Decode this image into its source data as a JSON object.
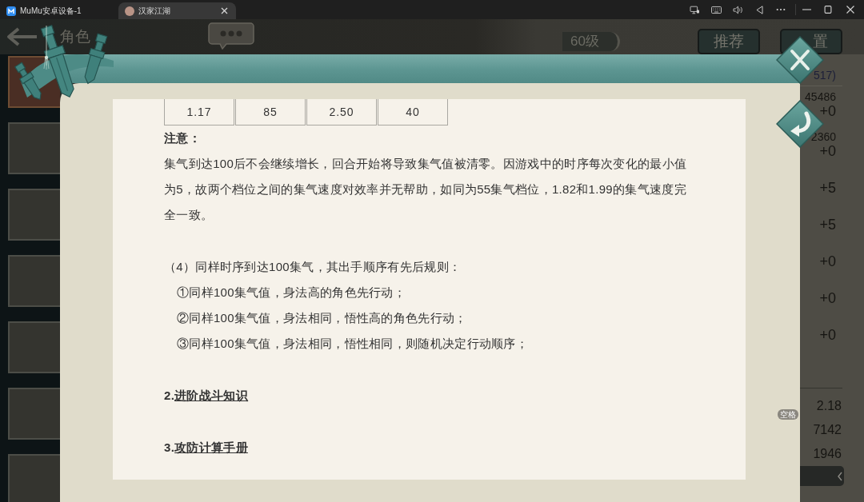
{
  "window": {
    "tabs": [
      {
        "kind": "launcher",
        "label": "MuMu安卓设备-1",
        "selected": false
      },
      {
        "kind": "app",
        "label": "汉家江湖",
        "selected": true
      }
    ]
  },
  "game": {
    "header": {
      "title": "角色",
      "level": "60级",
      "buttons": [
        "推荐",
        "置"
      ]
    },
    "portraits": [
      {
        "selected": true
      },
      {
        "selected": false
      },
      {
        "selected": false
      },
      {
        "selected": false
      },
      {
        "selected": false
      },
      {
        "selected": false
      },
      {
        "selected": false
      }
    ],
    "stats": {
      "header": "517)",
      "pairs": [
        {
          "value": "45486",
          "bonus": "+0"
        },
        {
          "value": "2360",
          "bonus": "+0"
        }
      ],
      "bonuses": [
        "+5",
        "+5",
        "+0",
        "+0",
        "+0"
      ],
      "totals": [
        "2.18",
        "7142",
        "1946"
      ]
    },
    "key_hint": "空格"
  },
  "dialog": {
    "table_row": [
      "1.17",
      "85",
      "2.50",
      "40"
    ],
    "note_title": "注意：",
    "note": "集气到达100后不会继续增长，回合开始将导致集气值被清零。因游戏中的时序每次变化的最小值为5，故两个档位之间的集气速度对效率并无帮助，如同为55集气档位，1.82和1.99的集气速度完全一致。",
    "rules_heading": "（4）同样时序到达100集气，其出手顺序有先后规则：",
    "rules": [
      "①同样100集气值，身法高的角色先行动；",
      "②同样100集气值，身法相同，悟性高的角色先行动；",
      "③同样100集气值，身法相同，悟性相同，则随机决定行动顺序；"
    ],
    "sections": [
      {
        "number": "2.",
        "link": "进阶战斗知识"
      },
      {
        "number": "3.",
        "link": "攻防计算手册"
      }
    ]
  }
}
